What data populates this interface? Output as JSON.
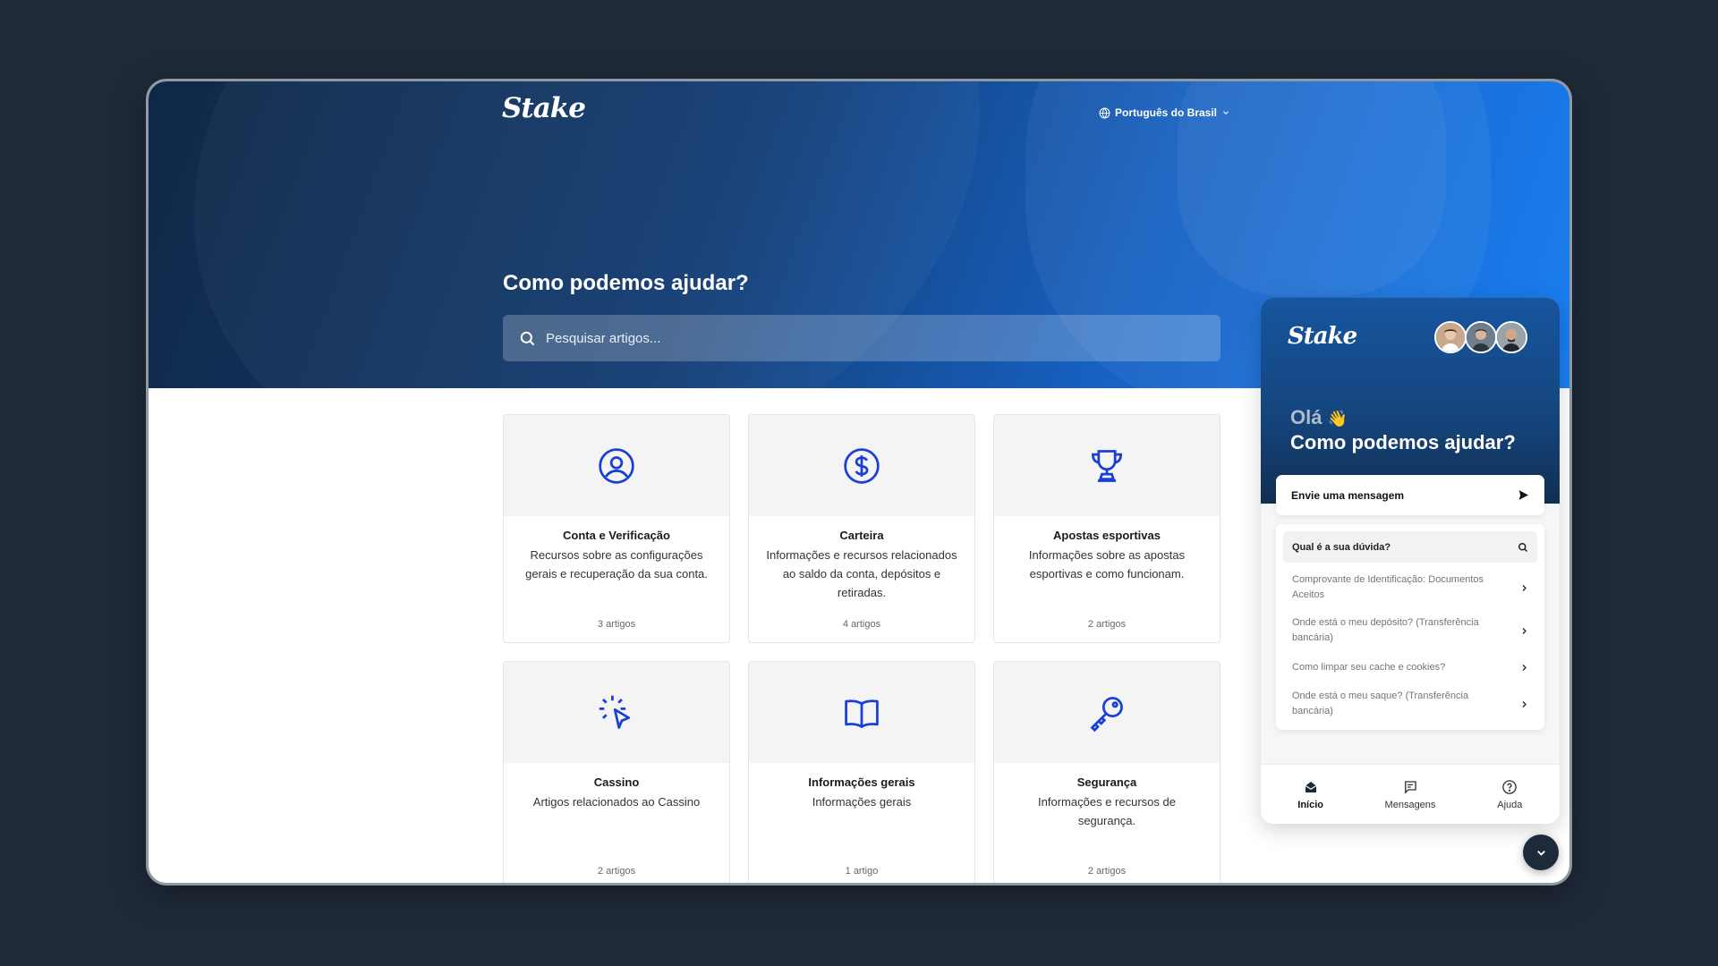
{
  "header": {
    "logo_text": "Stake",
    "language": "Português do Brasil",
    "title": "Como podemos ajudar?",
    "search_placeholder": "Pesquisar artigos..."
  },
  "categories": [
    {
      "icon": "user-circle-icon",
      "title": "Conta e Verificação",
      "description": "Recursos sobre as configurações gerais e recuperação da sua conta.",
      "count": "3 artigos"
    },
    {
      "icon": "dollar-circle-icon",
      "title": "Carteira",
      "description": "Informações e recursos relacionados ao saldo da conta, depósitos e retiradas.",
      "count": "4 artigos"
    },
    {
      "icon": "trophy-icon",
      "title": "Apostas esportivas",
      "description": "Informações sobre as apostas esportivas e como funcionam.",
      "count": "2 artigos"
    },
    {
      "icon": "cursor-click-icon",
      "title": "Cassino",
      "description": "Artigos relacionados ao Cassino",
      "count": "2 artigos"
    },
    {
      "icon": "book-open-icon",
      "title": "Informações gerais",
      "description": "Informações gerais",
      "count": "1 artigo"
    },
    {
      "icon": "key-icon",
      "title": "Segurança",
      "description": "Informações e recursos de segurança.",
      "count": "2 artigos"
    }
  ],
  "widget": {
    "logo_text": "Stake",
    "greeting": "Olá",
    "greeting_emoji": "👋",
    "title": "Como podemos ajudar?",
    "send_message_label": "Envie uma mensagem",
    "faq_search_label": "Qual é a sua dúvida?",
    "faq_items": [
      "Comprovante de Identificação: Documentos Aceitos",
      "Onde está o meu depósito? (Transferência bancária)",
      "Como limpar seu cache e cookies?",
      "Onde está o meu saque? (Transferência bancária)"
    ],
    "nav": [
      {
        "icon": "home-icon",
        "label": "Início",
        "active": true
      },
      {
        "icon": "messages-icon",
        "label": "Mensagens",
        "active": false
      },
      {
        "icon": "help-icon",
        "label": "Ajuda",
        "active": false
      }
    ]
  },
  "colors": {
    "icon_blue": "#1a3fd6",
    "hero_dark": "#0f2746",
    "hero_light": "#1a7ef0"
  }
}
